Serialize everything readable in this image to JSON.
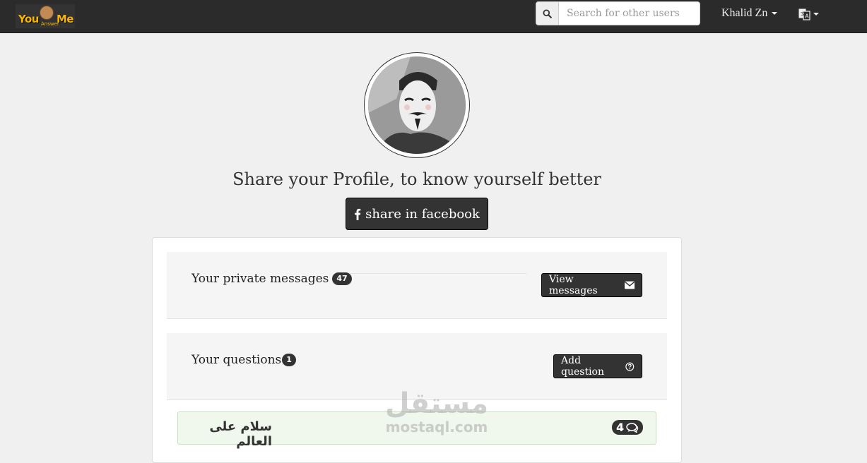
{
  "navbar": {
    "logo": {
      "you": "You",
      "answer": "Answer",
      "me": "Me"
    },
    "search": {
      "placeholder": "Search for other users",
      "value": ""
    },
    "user_name": "Khalid Zn",
    "icons": {
      "search": "search-icon",
      "language": "language-icon",
      "caret": "caret-down-icon"
    }
  },
  "profile": {
    "tagline": "Share your Profile, to know yourself better",
    "share_button": "share in facebook"
  },
  "panel": {
    "messages": {
      "label": "Your private messages",
      "count": "47",
      "button": "View messages"
    },
    "questions": {
      "label": "Your questions",
      "count": "1",
      "button": "Add question"
    },
    "question_items": [
      {
        "text": "سلام على العالم",
        "comment_count": "4"
      }
    ]
  },
  "watermark": {
    "arabic": "مستقل",
    "latin": "mostaql.com"
  },
  "colors": {
    "navbar_bg": "#2b2b2b",
    "logo_accent": "#f6b600",
    "page_bg": "#f0f0f0",
    "dark_button": "#333333",
    "question_bg": "#f0f7ec"
  }
}
